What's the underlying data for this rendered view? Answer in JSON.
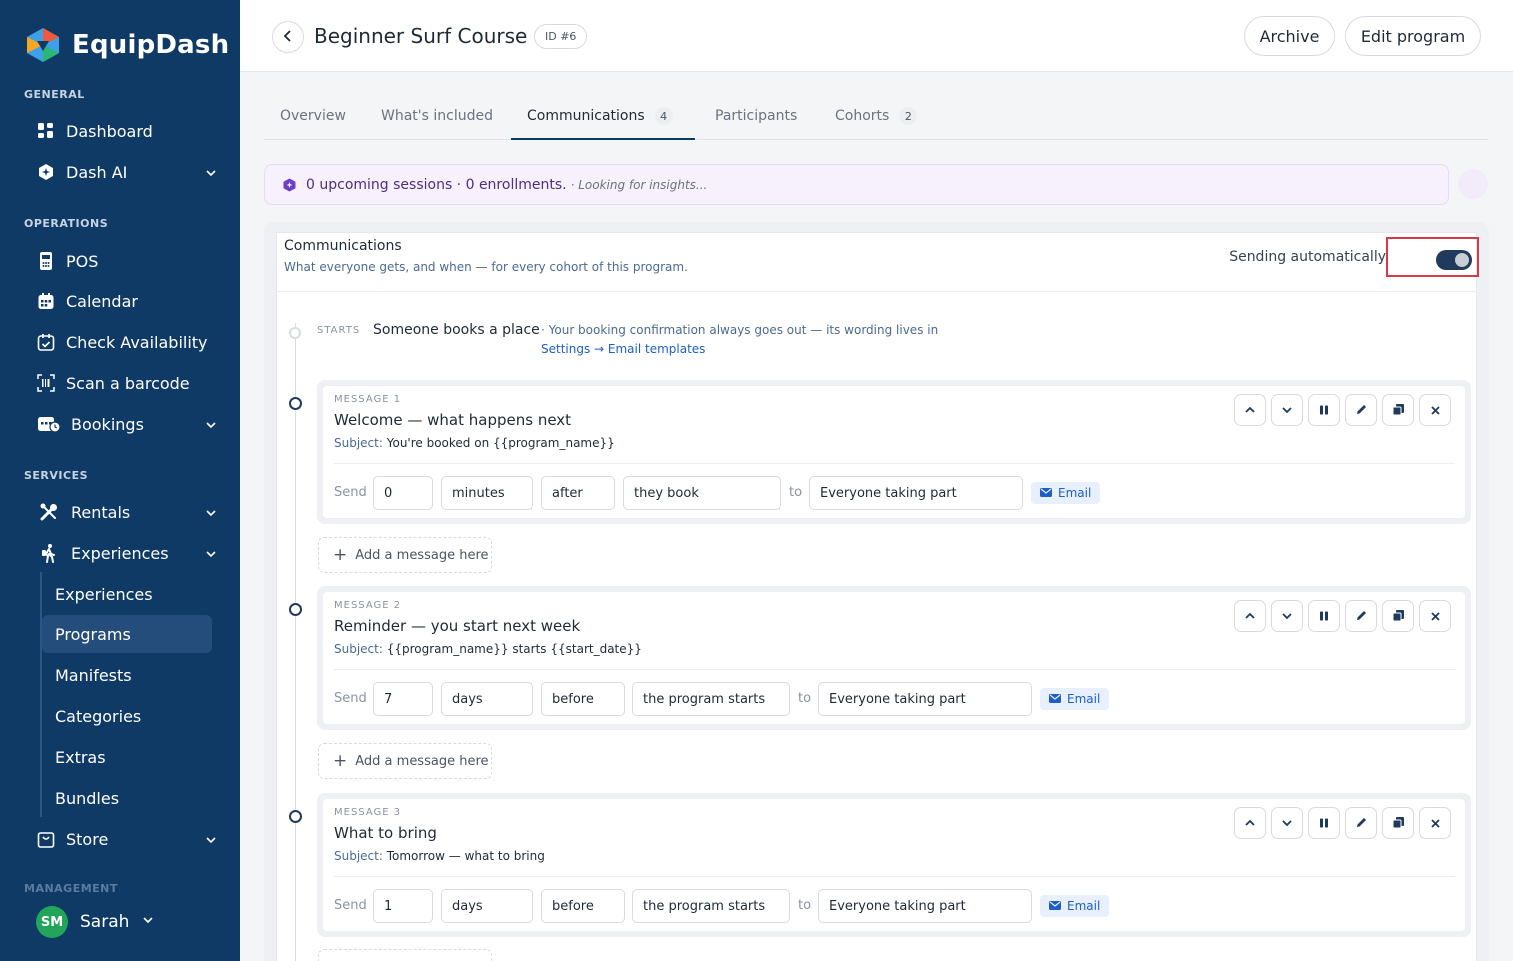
{
  "brand": {
    "name": "EquipDash"
  },
  "sidebar": {
    "general_label": "GENERAL",
    "operations_label": "OPERATIONS",
    "services_label": "SERVICES",
    "management_label": "MANAGEMENT",
    "items": {
      "dashboard": "Dashboard",
      "dash_ai": "Dash AI",
      "pos": "POS",
      "calendar": "Calendar",
      "check_availability": "Check Availability",
      "scan_barcode": "Scan a barcode",
      "bookings": "Bookings",
      "rentals": "Rentals",
      "experiences": "Experiences",
      "store": "Store"
    },
    "sub_items": [
      "Experiences",
      "Programs",
      "Manifests",
      "Categories",
      "Extras",
      "Bundles"
    ],
    "user": {
      "initials": "SM",
      "name": "Sarah"
    }
  },
  "header": {
    "title": "Beginner Surf Course",
    "id_badge": "ID #6",
    "archive_label": "Archive",
    "edit_label": "Edit program"
  },
  "tabs": [
    {
      "label": "Overview"
    },
    {
      "label": "What's included"
    },
    {
      "label": "Communications",
      "count": "4"
    },
    {
      "label": "Participants"
    },
    {
      "label": "Cohorts",
      "count": "2"
    }
  ],
  "insight": {
    "text": "0 upcoming sessions · 0 enrollments.",
    "loading": "· Looking for insights..."
  },
  "communications": {
    "title": "Communications",
    "subtitle": "What everyone gets, and when — for every cohort of this program.",
    "auto_label": "Sending automatically",
    "auto_enabled": true,
    "starts_label": "STARTS",
    "starts_text": "Someone books a place",
    "starts_note": "· Your booking confirmation always goes out — its wording lives in",
    "starts_link": "Settings → Email templates",
    "add_label": "Add a message here",
    "send_label": "Send",
    "to_label": "to",
    "messages": [
      {
        "label": "MESSAGE 1",
        "title": "Welcome — what happens next",
        "subject_label": "Subject:",
        "subject": "You're booked on {{program_name}}",
        "amount": "0",
        "unit": "minutes",
        "direction": "after",
        "event": "they book",
        "audience": "Everyone taking part",
        "channel": "Email"
      },
      {
        "label": "MESSAGE 2",
        "title": "Reminder — you start next week",
        "subject_label": "Subject:",
        "subject": "{{program_name}} starts {{start_date}}",
        "amount": "7",
        "unit": "days",
        "direction": "before",
        "event": "the program starts",
        "audience": "Everyone taking part",
        "channel": "Email"
      },
      {
        "label": "MESSAGE 3",
        "title": "What to bring",
        "subject_label": "Subject:",
        "subject": "Tomorrow — what to bring",
        "amount": "1",
        "unit": "days",
        "direction": "before",
        "event": "the program starts",
        "audience": "Everyone taking part",
        "channel": "Email"
      }
    ]
  },
  "colors": {
    "sidebar_bg": "#0f3a66",
    "accent": "#1d5fc4",
    "toggle_on": "#1f3a5c",
    "highlight_border": "#d63a48"
  }
}
